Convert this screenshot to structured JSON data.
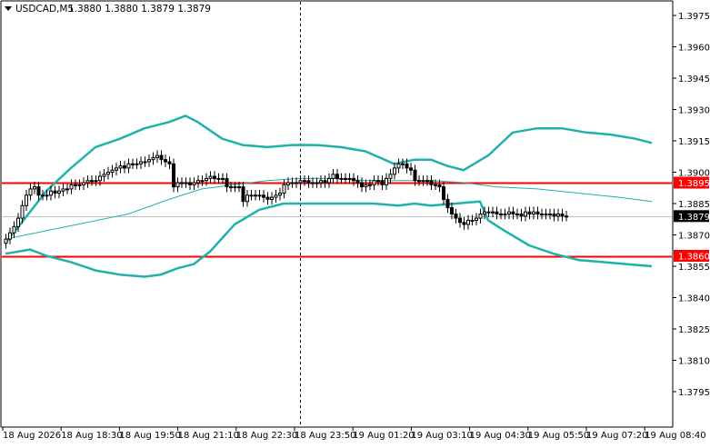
{
  "header": {
    "symbol": "USDCAD,M5",
    "ohlc": "1.3880 1.3880 1.3879 1.3879"
  },
  "colors": {
    "background": "#ffffff",
    "axis": "#000000",
    "candle": "#000000",
    "bollinger": "#20b2aa",
    "ma": "#20b2aa",
    "level_line": "#ff0000",
    "level_label_bg": "#ff0000",
    "level_label_text": "#ffffff",
    "bid_line": "#c0c0c0",
    "bid_label_bg": "#000000",
    "bid_label_text": "#ffffff"
  },
  "chart_data": {
    "type": "candlestick",
    "symbol": "USDCAD",
    "timeframe": "M5",
    "ylim": [
      1.3788,
      1.3983
    ],
    "y_ticks": [
      "1.3975",
      "1.3960",
      "1.3945",
      "1.3930",
      "1.3915",
      "1.3900",
      "1.3885",
      "1.3870",
      "1.3855",
      "1.3840",
      "1.3825",
      "1.3810",
      "1.3795"
    ],
    "x_ticks": [
      "18 Aug 2026",
      "18 Aug 18:30",
      "18 Aug 19:50",
      "18 Aug 21:10",
      "18 Aug 22:30",
      "18 Aug 23:50",
      "19 Aug 01:20",
      "19 Aug 03:10",
      "19 Aug 04:30",
      "19 Aug 05:50",
      "19 Aug 07:20",
      "19 Aug 08:40"
    ],
    "current_price": "1.3879",
    "levels": [
      {
        "label": "1.3895",
        "value": 1.3895
      },
      {
        "label": "1.3860",
        "value": 1.386
      }
    ],
    "period_separator_after_tick": "18 Aug 22:30",
    "close": [
      1.3868,
      1.3871,
      1.3874,
      1.3878,
      1.3884,
      1.3889,
      1.3892,
      1.3893,
      1.3889,
      1.3889,
      1.3889,
      1.3891,
      1.389,
      1.3891,
      1.3892,
      1.3892,
      1.3894,
      1.3894,
      1.3894,
      1.3895,
      1.3896,
      1.3896,
      1.3896,
      1.3898,
      1.3899,
      1.39,
      1.3901,
      1.3902,
      1.3903,
      1.3902,
      1.3904,
      1.3904,
      1.3904,
      1.3905,
      1.3905,
      1.3906,
      1.3907,
      1.3908,
      1.3906,
      1.3905,
      1.3904,
      1.3893,
      1.3895,
      1.3895,
      1.3895,
      1.3894,
      1.3895,
      1.3896,
      1.3896,
      1.3897,
      1.3898,
      1.3897,
      1.3897,
      1.3897,
      1.3893,
      1.3893,
      1.3893,
      1.3893,
      1.3886,
      1.3889,
      1.3889,
      1.3889,
      1.3889,
      1.3888,
      1.3887,
      1.3888,
      1.3889,
      1.389,
      1.3894,
      1.3895,
      1.3895,
      1.3895,
      1.3896,
      1.3896,
      1.3895,
      1.3895,
      1.3895,
      1.3896,
      1.3895,
      1.3897,
      1.3899,
      1.3897,
      1.3897,
      1.3897,
      1.3897,
      1.3896,
      1.3895,
      1.3893,
      1.3894,
      1.3894,
      1.3896,
      1.3896,
      1.3894,
      1.3897,
      1.3899,
      1.3902,
      1.3904,
      1.3904,
      1.3902,
      1.3901,
      1.3896,
      1.3896,
      1.3896,
      1.3896,
      1.3894,
      1.3894,
      1.3893,
      1.3887,
      1.3883,
      1.388,
      1.3878,
      1.3876,
      1.3875,
      1.3877,
      1.3877,
      1.3878,
      1.388,
      1.3881,
      1.3881,
      1.3881,
      1.388,
      1.388,
      1.388,
      1.3881,
      1.388,
      1.388,
      1.3879,
      1.3881,
      1.388,
      1.3881,
      1.388,
      1.388,
      1.388,
      1.388,
      1.3879,
      1.388,
      1.3879,
      1.3879
    ],
    "bollinger_upper": [
      [
        0,
        1.3866
      ],
      [
        10,
        1.3891
      ],
      [
        16,
        1.3902
      ],
      [
        22,
        1.3912
      ],
      [
        28,
        1.3916
      ],
      [
        34,
        1.3921
      ],
      [
        40,
        1.3924
      ],
      [
        44,
        1.3927
      ],
      [
        47,
        1.3924
      ],
      [
        53,
        1.3916
      ],
      [
        58,
        1.3913
      ],
      [
        64,
        1.3912
      ],
      [
        70,
        1.3913
      ],
      [
        76,
        1.3913
      ],
      [
        82,
        1.3912
      ],
      [
        88,
        1.391
      ],
      [
        95,
        1.3904
      ],
      [
        100,
        1.3906
      ],
      [
        104,
        1.3906
      ],
      [
        108,
        1.3903
      ],
      [
        112,
        1.3901
      ],
      [
        118,
        1.3908
      ],
      [
        124,
        1.3919
      ],
      [
        130,
        1.3921
      ],
      [
        136,
        1.3921
      ],
      [
        142,
        1.3919
      ],
      [
        148,
        1.3918
      ],
      [
        154,
        1.3916
      ],
      [
        158,
        1.3914
      ]
    ],
    "bollinger_middle": [
      [
        0,
        1.3868
      ],
      [
        10,
        1.3872
      ],
      [
        20,
        1.3876
      ],
      [
        30,
        1.388
      ],
      [
        40,
        1.3887
      ],
      [
        48,
        1.3892
      ],
      [
        56,
        1.3894
      ],
      [
        64,
        1.3896
      ],
      [
        72,
        1.3897
      ],
      [
        80,
        1.3897
      ],
      [
        88,
        1.3896
      ],
      [
        96,
        1.3896
      ],
      [
        104,
        1.3896
      ],
      [
        112,
        1.3895
      ],
      [
        120,
        1.3893
      ],
      [
        130,
        1.3892
      ],
      [
        140,
        1.389
      ],
      [
        150,
        1.3888
      ],
      [
        158,
        1.3886
      ]
    ],
    "bollinger_lower": [
      [
        0,
        1.3861
      ],
      [
        6,
        1.3863
      ],
      [
        10,
        1.386
      ],
      [
        16,
        1.3857
      ],
      [
        22,
        1.3853
      ],
      [
        28,
        1.3851
      ],
      [
        34,
        1.385
      ],
      [
        38,
        1.3851
      ],
      [
        42,
        1.3854
      ],
      [
        46,
        1.3856
      ],
      [
        50,
        1.3862
      ],
      [
        56,
        1.3875
      ],
      [
        62,
        1.3882
      ],
      [
        68,
        1.3885
      ],
      [
        76,
        1.3885
      ],
      [
        84,
        1.3885
      ],
      [
        90,
        1.3885
      ],
      [
        96,
        1.3884
      ],
      [
        100,
        1.3885
      ],
      [
        104,
        1.3884
      ],
      [
        110,
        1.3885
      ],
      [
        116,
        1.3886
      ],
      [
        118,
        1.3877
      ],
      [
        122,
        1.3872
      ],
      [
        128,
        1.3865
      ],
      [
        134,
        1.3861
      ],
      [
        140,
        1.3858
      ],
      [
        146,
        1.3857
      ],
      [
        152,
        1.3856
      ],
      [
        158,
        1.3855
      ]
    ]
  }
}
